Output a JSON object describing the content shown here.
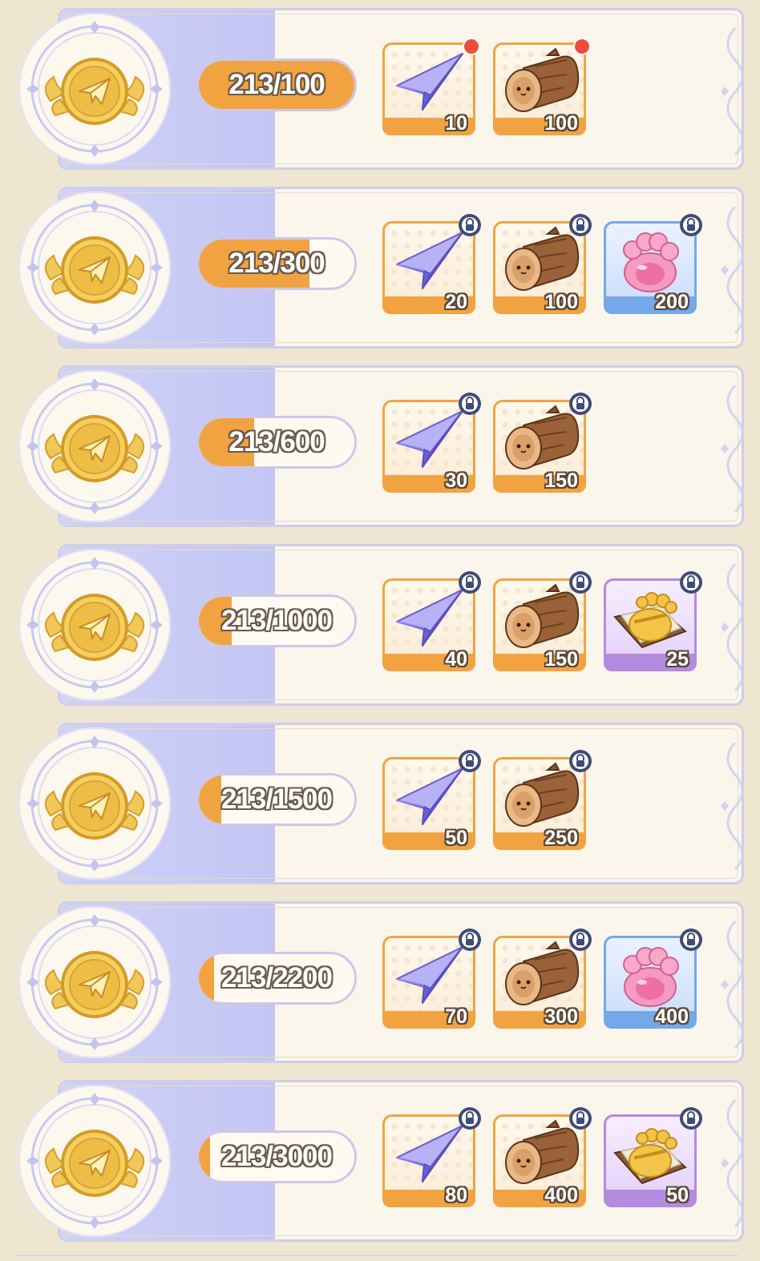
{
  "milestones": [
    {
      "progress": "213/100",
      "fraction": 1.0,
      "rewards": [
        {
          "icon": "paper-plane-icon",
          "qty": "10",
          "frame": "orange",
          "status": "claimable"
        },
        {
          "icon": "wood-log-icon",
          "qty": "100",
          "frame": "orange",
          "status": "claimable"
        }
      ]
    },
    {
      "progress": "213/300",
      "fraction": 0.71,
      "rewards": [
        {
          "icon": "paper-plane-icon",
          "qty": "20",
          "frame": "orange",
          "status": "locked"
        },
        {
          "icon": "wood-log-icon",
          "qty": "100",
          "frame": "orange",
          "status": "locked"
        },
        {
          "icon": "paw-jelly-icon",
          "qty": "200",
          "frame": "blue",
          "status": "locked"
        }
      ]
    },
    {
      "progress": "213/600",
      "fraction": 0.355,
      "rewards": [
        {
          "icon": "paper-plane-icon",
          "qty": "30",
          "frame": "orange",
          "status": "locked"
        },
        {
          "icon": "wood-log-icon",
          "qty": "150",
          "frame": "orange",
          "status": "locked"
        }
      ]
    },
    {
      "progress": "213/1000",
      "fraction": 0.213,
      "rewards": [
        {
          "icon": "paper-plane-icon",
          "qty": "40",
          "frame": "orange",
          "status": "locked"
        },
        {
          "icon": "wood-log-icon",
          "qty": "150",
          "frame": "orange",
          "status": "locked"
        },
        {
          "icon": "golden-paw-stamp-icon",
          "qty": "25",
          "frame": "purple",
          "status": "locked"
        }
      ]
    },
    {
      "progress": "213/1500",
      "fraction": 0.142,
      "rewards": [
        {
          "icon": "paper-plane-icon",
          "qty": "50",
          "frame": "orange",
          "status": "locked"
        },
        {
          "icon": "wood-log-icon",
          "qty": "250",
          "frame": "orange",
          "status": "locked"
        }
      ]
    },
    {
      "progress": "213/2200",
      "fraction": 0.097,
      "rewards": [
        {
          "icon": "paper-plane-icon",
          "qty": "70",
          "frame": "orange",
          "status": "locked"
        },
        {
          "icon": "wood-log-icon",
          "qty": "300",
          "frame": "orange",
          "status": "locked"
        },
        {
          "icon": "paw-jelly-icon",
          "qty": "400",
          "frame": "blue",
          "status": "locked"
        }
      ]
    },
    {
      "progress": "213/3000",
      "fraction": 0.071,
      "rewards": [
        {
          "icon": "paper-plane-icon",
          "qty": "80",
          "frame": "orange",
          "status": "locked"
        },
        {
          "icon": "wood-log-icon",
          "qty": "400",
          "frame": "orange",
          "status": "locked"
        },
        {
          "icon": "golden-paw-stamp-icon",
          "qty": "50",
          "frame": "purple",
          "status": "locked"
        }
      ]
    }
  ],
  "colors": {
    "progress_fill": "#f2a341",
    "claim_dot": "#ef4b3b",
    "lock_badge": "#3f4b78",
    "band": "#c9ccf4"
  }
}
